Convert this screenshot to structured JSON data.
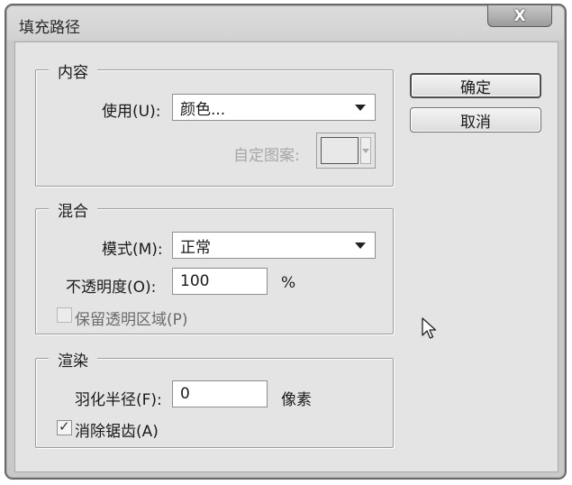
{
  "dialog": {
    "title": "填充路径",
    "close_symbol": "X"
  },
  "content_group": {
    "legend": "内容",
    "use_label": "使用(U):",
    "use_value": "颜色...",
    "custom_pattern_label": "自定图案:"
  },
  "blend_group": {
    "legend": "混合",
    "mode_label": "模式(M):",
    "mode_value": "正常",
    "opacity_label": "不透明度(O):",
    "opacity_value": "100",
    "opacity_unit": "%",
    "preserve_transparency_label": "保留透明区域(P)",
    "preserve_transparency_checked": false
  },
  "render_group": {
    "legend": "渲染",
    "feather_label": "羽化半径(F):",
    "feather_value": "0",
    "feather_unit": "像素",
    "antialias_label": "消除锯齿(A)",
    "antialias_checked": true
  },
  "buttons": {
    "ok": "确定",
    "cancel": "取消"
  },
  "icons": {
    "close": "close-icon",
    "cursor": "mouse-pointer-icon",
    "dropdown": "chevron-down-icon",
    "check": "checkmark-icon"
  }
}
